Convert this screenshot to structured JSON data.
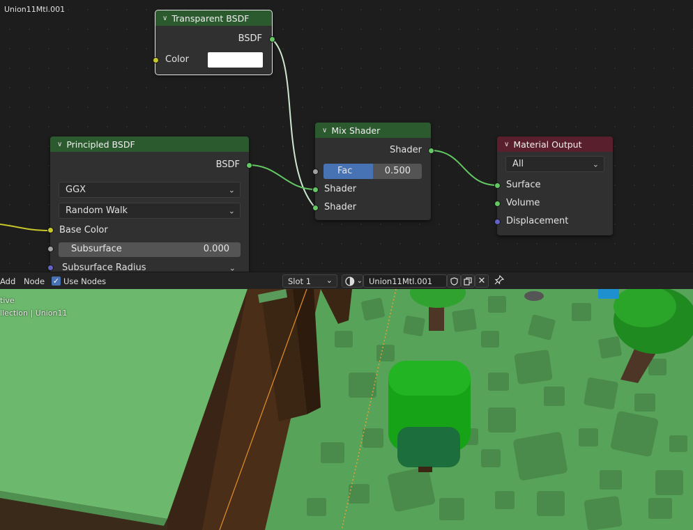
{
  "editor": {
    "material_label": "Union11Mtl.001"
  },
  "nodes": {
    "transparent": {
      "title": "Transparent BSDF",
      "output_label": "BSDF",
      "input_label": "Color",
      "color_value": "#ffffff"
    },
    "principled": {
      "title": "Principled BSDF",
      "output_label": "BSDF",
      "distribution": "GGX",
      "subsurface_method": "Random Walk",
      "base_color_label": "Base Color",
      "subsurface_label": "Subsurface",
      "subsurface_value": "0.000",
      "subsurface_radius_label": "Subsurface Radius"
    },
    "mix": {
      "title": "Mix Shader",
      "output_label": "Shader",
      "fac_label": "Fac",
      "fac_value": "0.500",
      "fac_fraction": 0.5,
      "input1_label": "Shader",
      "input2_label": "Shader"
    },
    "output": {
      "title": "Material Output",
      "target": "All",
      "surface_label": "Surface",
      "volume_label": "Volume",
      "displacement_label": "Displacement"
    }
  },
  "header": {
    "add_label": "Add",
    "node_label": "Node",
    "use_nodes_label": "Use Nodes",
    "use_nodes_checked": true,
    "slot": "Slot 1",
    "material_name": "Union11Mtl.001"
  },
  "viewport": {
    "line1": "tive",
    "line2": "llection | Union11"
  },
  "colors": {
    "shader_node_header": "#2c5a2f",
    "output_node_header": "#5a1f2c",
    "shader_socket": "#63c763",
    "color_socket": "#c7c729",
    "float_socket": "#a1a1a1",
    "vector_socket": "#6363c7",
    "accent": "#4772b3",
    "ground": "#58a35a"
  }
}
